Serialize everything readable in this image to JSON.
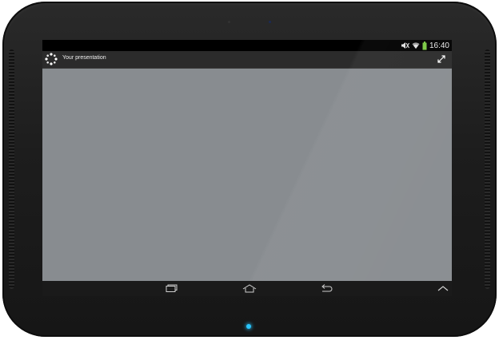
{
  "status_bar": {
    "time": "16:40",
    "icons": [
      "mute-icon",
      "wifi-icon",
      "battery-icon"
    ]
  },
  "action_bar": {
    "app_icon": "app-logo-icon",
    "title": "Your presentation",
    "action_icon": "fullscreen-expand-icon"
  },
  "navigation_bar": {
    "buttons": [
      "recent-apps-icon",
      "home-icon",
      "back-icon",
      "chevron-up-icon"
    ]
  },
  "colors": {
    "content_background": "#888c90",
    "action_bar": "#2b2b2b",
    "battery": "#7ac943",
    "led": "#29c6ff"
  }
}
